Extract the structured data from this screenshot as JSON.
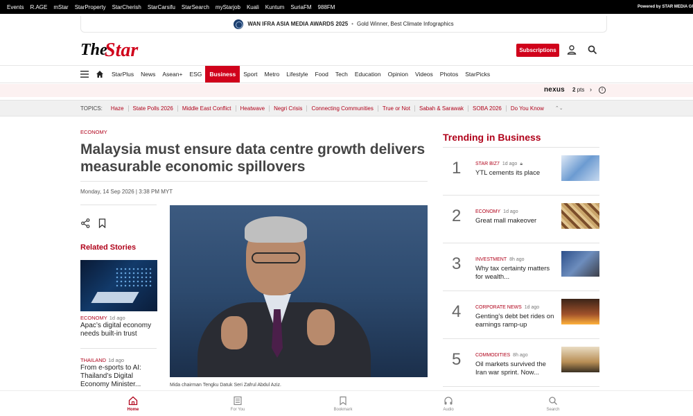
{
  "topbar": {
    "links": [
      "Events",
      "R.AGE",
      "mStar",
      "StarProperty",
      "StarCherish",
      "StarCarsifu",
      "StarSearch",
      "myStarjob",
      "Kuali",
      "Kuntum",
      "SuriaFM",
      "988FM"
    ],
    "powered": "Powered by STAR MEDIA GR"
  },
  "award": {
    "title": "WAN IFRA ASIA MEDIA AWARDS 2025",
    "separator": "•",
    "subtitle": "Gold Winner, Best Climate Infographics"
  },
  "masthead": {
    "logo_the": "The",
    "logo_star": "Star",
    "subscribe_label": "Subscriptions"
  },
  "nav": {
    "items": [
      "StarPlus",
      "News",
      "Asean+",
      "ESG",
      "Business",
      "Sport",
      "Metro",
      "Lifestyle",
      "Food",
      "Tech",
      "Education",
      "Opinion",
      "Videos",
      "Photos",
      "StarPicks"
    ],
    "active": "Business"
  },
  "nexus": {
    "brand": "nexus",
    "points": "2",
    "points_unit": "pts"
  },
  "topics": {
    "label": "TOPICS:",
    "items": [
      "Haze",
      "State Polls 2026",
      "Middle East Conflict",
      "Heatwave",
      "Negri Crisis",
      "Connecting Communities",
      "True or Not",
      "Sabah & Sarawak",
      "SOBA 2026",
      "Do You Know"
    ]
  },
  "article": {
    "category": "ECONOMY",
    "headline": "Malaysia must ensure data centre growth delivers measurable economic spillovers",
    "date": "Monday, 14 Sep 2026 | 3:38 PM MYT",
    "caption": "Mida chairman Tengku Datuk Seri Zafrul Abdul Aziz."
  },
  "related": {
    "title": "Related Stories",
    "items": [
      {
        "category": "ECONOMY",
        "ago": "1d ago",
        "title": "Apac’s digital economy needs built-in trust"
      },
      {
        "category": "THAILAND",
        "ago": "1d ago",
        "title": "From e-sports to AI: Thailand’s Digital Economy Minister..."
      }
    ]
  },
  "trending": {
    "title": "Trending in Business",
    "items": [
      {
        "num": "1",
        "category": "STAR BIZ7",
        "ago": "1d ago",
        "title": "YTL cements its place"
      },
      {
        "num": "2",
        "category": "ECONOMY",
        "ago": "1d ago",
        "title": "Great mall makeover"
      },
      {
        "num": "3",
        "category": "INVESTMENT",
        "ago": "8h ago",
        "title": "Why tax certainty matters for wealth..."
      },
      {
        "num": "4",
        "category": "CORPORATE NEWS",
        "ago": "1d ago",
        "title": "Genting’s debt bet rides on earnings ramp-up"
      },
      {
        "num": "5",
        "category": "COMMODITIES",
        "ago": "8h ago",
        "title": "Oil markets survived the Iran war sprint. Now..."
      }
    ]
  },
  "bottomnav": {
    "items": [
      "Home",
      "For You",
      "Bookmark",
      "Audio",
      "Search"
    ],
    "active": "Home"
  },
  "colors": {
    "brand_red": "#d0021b",
    "topic_red": "#b0021a"
  }
}
